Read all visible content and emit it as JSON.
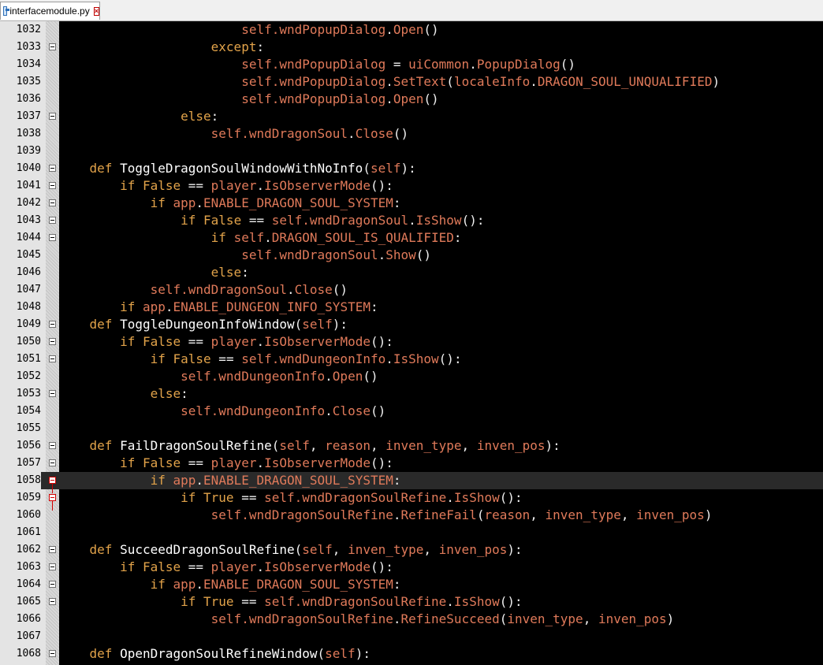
{
  "tab": {
    "filename": "interfacemodule.py",
    "icon": "python-file-icon",
    "close_icon": "close-icon"
  },
  "colors": {
    "background": "#000000",
    "keyword": "#e2a34a",
    "identifier": "#e07a5a",
    "default": "#f0f0f0",
    "gutter": "#e4e4e4",
    "fold_marker_active": "#d00000"
  },
  "lines": [
    {
      "num": "1032",
      "fold": "",
      "indent": "                        ",
      "tokens": [
        [
          "sf",
          "self.wndPopupDialog"
        ],
        [
          "pl",
          "."
        ],
        [
          "sf",
          "Open"
        ],
        [
          "pl",
          "()"
        ]
      ]
    },
    {
      "num": "1033",
      "fold": "minus",
      "indent": "                    ",
      "tokens": [
        [
          "kw",
          "except"
        ],
        [
          "pl",
          ":"
        ]
      ]
    },
    {
      "num": "1034",
      "fold": "",
      "indent": "                        ",
      "tokens": [
        [
          "sf",
          "self.wndPopupDialog"
        ],
        [
          "pl",
          " = "
        ],
        [
          "sf",
          "uiCommon"
        ],
        [
          "pl",
          "."
        ],
        [
          "sf",
          "PopupDialog"
        ],
        [
          "pl",
          "()"
        ]
      ]
    },
    {
      "num": "1035",
      "fold": "",
      "indent": "                        ",
      "tokens": [
        [
          "sf",
          "self.wndPopupDialog"
        ],
        [
          "pl",
          "."
        ],
        [
          "sf",
          "SetText"
        ],
        [
          "pl",
          "("
        ],
        [
          "sf",
          "localeInfo"
        ],
        [
          "pl",
          "."
        ],
        [
          "sf",
          "DRAGON_SOUL_UNQUALIFIED"
        ],
        [
          "pl",
          ")"
        ]
      ]
    },
    {
      "num": "1036",
      "fold": "",
      "indent": "                        ",
      "tokens": [
        [
          "sf",
          "self.wndPopupDialog"
        ],
        [
          "pl",
          "."
        ],
        [
          "sf",
          "Open"
        ],
        [
          "pl",
          "()"
        ]
      ]
    },
    {
      "num": "1037",
      "fold": "minus",
      "indent": "                ",
      "tokens": [
        [
          "kw",
          "else"
        ],
        [
          "pl",
          ":"
        ]
      ]
    },
    {
      "num": "1038",
      "fold": "",
      "indent": "                    ",
      "tokens": [
        [
          "sf",
          "self.wndDragonSoul"
        ],
        [
          "pl",
          "."
        ],
        [
          "sf",
          "Close"
        ],
        [
          "pl",
          "()"
        ]
      ]
    },
    {
      "num": "1039",
      "fold": "",
      "indent": "",
      "tokens": []
    },
    {
      "num": "1040",
      "fold": "minus",
      "indent": "    ",
      "tokens": [
        [
          "kw",
          "def "
        ],
        [
          "fn",
          "ToggleDragonSoulWindowWithNoInfo"
        ],
        [
          "pl",
          "("
        ],
        [
          "sf",
          "self"
        ],
        [
          "pl",
          "):"
        ]
      ]
    },
    {
      "num": "1041",
      "fold": "minus",
      "indent": "        ",
      "tokens": [
        [
          "kw",
          "if "
        ],
        [
          "kw",
          "False"
        ],
        [
          "pl",
          " == "
        ],
        [
          "sf",
          "player"
        ],
        [
          "pl",
          "."
        ],
        [
          "sf",
          "IsObserverMode"
        ],
        [
          "pl",
          "():"
        ]
      ]
    },
    {
      "num": "1042",
      "fold": "minus",
      "indent": "            ",
      "tokens": [
        [
          "kw",
          "if "
        ],
        [
          "sf",
          "app"
        ],
        [
          "pl",
          "."
        ],
        [
          "sf",
          "ENABLE_DRAGON_SOUL_SYSTEM"
        ],
        [
          "pl",
          ":"
        ]
      ]
    },
    {
      "num": "1043",
      "fold": "minus",
      "indent": "                ",
      "tokens": [
        [
          "kw",
          "if "
        ],
        [
          "kw",
          "False"
        ],
        [
          "pl",
          " == "
        ],
        [
          "sf",
          "self.wndDragonSoul"
        ],
        [
          "pl",
          "."
        ],
        [
          "sf",
          "IsShow"
        ],
        [
          "pl",
          "():"
        ]
      ]
    },
    {
      "num": "1044",
      "fold": "minus",
      "indent": "                    ",
      "tokens": [
        [
          "kw",
          "if "
        ],
        [
          "sf",
          "self"
        ],
        [
          "pl",
          "."
        ],
        [
          "sf",
          "DRAGON_SOUL_IS_QUALIFIED"
        ],
        [
          "pl",
          ":"
        ]
      ]
    },
    {
      "num": "1045",
      "fold": "",
      "indent": "                        ",
      "tokens": [
        [
          "sf",
          "self.wndDragonSoul"
        ],
        [
          "pl",
          "."
        ],
        [
          "sf",
          "Show"
        ],
        [
          "pl",
          "()"
        ]
      ]
    },
    {
      "num": "1046",
      "fold": "",
      "indent": "                    ",
      "tokens": [
        [
          "kw",
          "else"
        ],
        [
          "pl",
          ":"
        ]
      ]
    },
    {
      "num": "1047",
      "fold": "",
      "indent": "            ",
      "tokens": [
        [
          "sf",
          "self.wndDragonSoul"
        ],
        [
          "pl",
          "."
        ],
        [
          "sf",
          "Close"
        ],
        [
          "pl",
          "()"
        ]
      ]
    },
    {
      "num": "1048",
      "fold": "",
      "indent": "        ",
      "tokens": [
        [
          "kw",
          "if "
        ],
        [
          "sf",
          "app"
        ],
        [
          "pl",
          "."
        ],
        [
          "sf",
          "ENABLE_DUNGEON_INFO_SYSTEM"
        ],
        [
          "pl",
          ":"
        ]
      ]
    },
    {
      "num": "1049",
      "fold": "minus",
      "indent": "    ",
      "tokens": [
        [
          "kw",
          "def "
        ],
        [
          "fn",
          "ToggleDungeonInfoWindow"
        ],
        [
          "pl",
          "("
        ],
        [
          "sf",
          "self"
        ],
        [
          "pl",
          "):"
        ]
      ]
    },
    {
      "num": "1050",
      "fold": "minus",
      "indent": "        ",
      "tokens": [
        [
          "kw",
          "if "
        ],
        [
          "kw",
          "False"
        ],
        [
          "pl",
          " == "
        ],
        [
          "sf",
          "player"
        ],
        [
          "pl",
          "."
        ],
        [
          "sf",
          "IsObserverMode"
        ],
        [
          "pl",
          "():"
        ]
      ]
    },
    {
      "num": "1051",
      "fold": "minus",
      "indent": "            ",
      "tokens": [
        [
          "kw",
          "if "
        ],
        [
          "kw",
          "False"
        ],
        [
          "pl",
          " == "
        ],
        [
          "sf",
          "self.wndDungeonInfo"
        ],
        [
          "pl",
          "."
        ],
        [
          "sf",
          "IsShow"
        ],
        [
          "pl",
          "():"
        ]
      ]
    },
    {
      "num": "1052",
      "fold": "",
      "indent": "                ",
      "tokens": [
        [
          "sf",
          "self.wndDungeonInfo"
        ],
        [
          "pl",
          "."
        ],
        [
          "sf",
          "Open"
        ],
        [
          "pl",
          "()"
        ]
      ]
    },
    {
      "num": "1053",
      "fold": "minus",
      "indent": "            ",
      "tokens": [
        [
          "kw",
          "else"
        ],
        [
          "pl",
          ":"
        ]
      ]
    },
    {
      "num": "1054",
      "fold": "",
      "indent": "                ",
      "tokens": [
        [
          "sf",
          "self.wndDungeonInfo"
        ],
        [
          "pl",
          "."
        ],
        [
          "sf",
          "Close"
        ],
        [
          "pl",
          "()"
        ]
      ]
    },
    {
      "num": "1055",
      "fold": "",
      "indent": "",
      "tokens": []
    },
    {
      "num": "1056",
      "fold": "minus",
      "indent": "    ",
      "tokens": [
        [
          "kw",
          "def "
        ],
        [
          "fn",
          "FailDragonSoulRefine"
        ],
        [
          "pl",
          "("
        ],
        [
          "sf",
          "self"
        ],
        [
          "pl",
          ", "
        ],
        [
          "sf",
          "reason"
        ],
        [
          "pl",
          ", "
        ],
        [
          "sf",
          "inven_type"
        ],
        [
          "pl",
          ", "
        ],
        [
          "sf",
          "inven_pos"
        ],
        [
          "pl",
          "):"
        ]
      ]
    },
    {
      "num": "1057",
      "fold": "minus",
      "indent": "        ",
      "tokens": [
        [
          "kw",
          "if "
        ],
        [
          "kw",
          "False"
        ],
        [
          "pl",
          " == "
        ],
        [
          "sf",
          "player"
        ],
        [
          "pl",
          "."
        ],
        [
          "sf",
          "IsObserverMode"
        ],
        [
          "pl",
          "():"
        ]
      ]
    },
    {
      "num": "1058",
      "fold": "red",
      "current": true,
      "indent": "            ",
      "tokens": [
        [
          "kw",
          "if "
        ],
        [
          "sf",
          "app"
        ],
        [
          "pl",
          "."
        ],
        [
          "sf",
          "ENABLE_DRAGON_SOUL_SYSTEM"
        ],
        [
          "pl",
          ":"
        ]
      ]
    },
    {
      "num": "1059",
      "fold": "red",
      "indent": "                ",
      "tokens": [
        [
          "kw",
          "if "
        ],
        [
          "kw",
          "True"
        ],
        [
          "pl",
          " == "
        ],
        [
          "sf",
          "self.wndDragonSoulRefine"
        ],
        [
          "pl",
          "."
        ],
        [
          "sf",
          "IsShow"
        ],
        [
          "pl",
          "():"
        ]
      ]
    },
    {
      "num": "1060",
      "fold": "",
      "indent": "                    ",
      "tokens": [
        [
          "sf",
          "self.wndDragonSoulRefine"
        ],
        [
          "pl",
          "."
        ],
        [
          "sf",
          "RefineFail"
        ],
        [
          "pl",
          "("
        ],
        [
          "sf",
          "reason"
        ],
        [
          "pl",
          ", "
        ],
        [
          "sf",
          "inven_type"
        ],
        [
          "pl",
          ", "
        ],
        [
          "sf",
          "inven_pos"
        ],
        [
          "pl",
          ")"
        ]
      ]
    },
    {
      "num": "1061",
      "fold": "",
      "indent": "",
      "tokens": []
    },
    {
      "num": "1062",
      "fold": "minus",
      "indent": "    ",
      "tokens": [
        [
          "kw",
          "def "
        ],
        [
          "fn",
          "SucceedDragonSoulRefine"
        ],
        [
          "pl",
          "("
        ],
        [
          "sf",
          "self"
        ],
        [
          "pl",
          ", "
        ],
        [
          "sf",
          "inven_type"
        ],
        [
          "pl",
          ", "
        ],
        [
          "sf",
          "inven_pos"
        ],
        [
          "pl",
          "):"
        ]
      ]
    },
    {
      "num": "1063",
      "fold": "minus",
      "indent": "        ",
      "tokens": [
        [
          "kw",
          "if "
        ],
        [
          "kw",
          "False"
        ],
        [
          "pl",
          " == "
        ],
        [
          "sf",
          "player"
        ],
        [
          "pl",
          "."
        ],
        [
          "sf",
          "IsObserverMode"
        ],
        [
          "pl",
          "():"
        ]
      ]
    },
    {
      "num": "1064",
      "fold": "minus",
      "indent": "            ",
      "tokens": [
        [
          "kw",
          "if "
        ],
        [
          "sf",
          "app"
        ],
        [
          "pl",
          "."
        ],
        [
          "sf",
          "ENABLE_DRAGON_SOUL_SYSTEM"
        ],
        [
          "pl",
          ":"
        ]
      ]
    },
    {
      "num": "1065",
      "fold": "minus",
      "indent": "                ",
      "tokens": [
        [
          "kw",
          "if "
        ],
        [
          "kw",
          "True"
        ],
        [
          "pl",
          " == "
        ],
        [
          "sf",
          "self.wndDragonSoulRefine"
        ],
        [
          "pl",
          "."
        ],
        [
          "sf",
          "IsShow"
        ],
        [
          "pl",
          "():"
        ]
      ]
    },
    {
      "num": "1066",
      "fold": "",
      "indent": "                    ",
      "tokens": [
        [
          "sf",
          "self.wndDragonSoulRefine"
        ],
        [
          "pl",
          "."
        ],
        [
          "sf",
          "RefineSucceed"
        ],
        [
          "pl",
          "("
        ],
        [
          "sf",
          "inven_type"
        ],
        [
          "pl",
          ", "
        ],
        [
          "sf",
          "inven_pos"
        ],
        [
          "pl",
          ")"
        ]
      ]
    },
    {
      "num": "1067",
      "fold": "",
      "indent": "",
      "tokens": []
    },
    {
      "num": "1068",
      "fold": "minus",
      "indent": "    ",
      "tokens": [
        [
          "kw",
          "def "
        ],
        [
          "fn",
          "OpenDragonSoulRefineWindow"
        ],
        [
          "pl",
          "("
        ],
        [
          "sf",
          "self"
        ],
        [
          "pl",
          "):"
        ]
      ]
    }
  ]
}
